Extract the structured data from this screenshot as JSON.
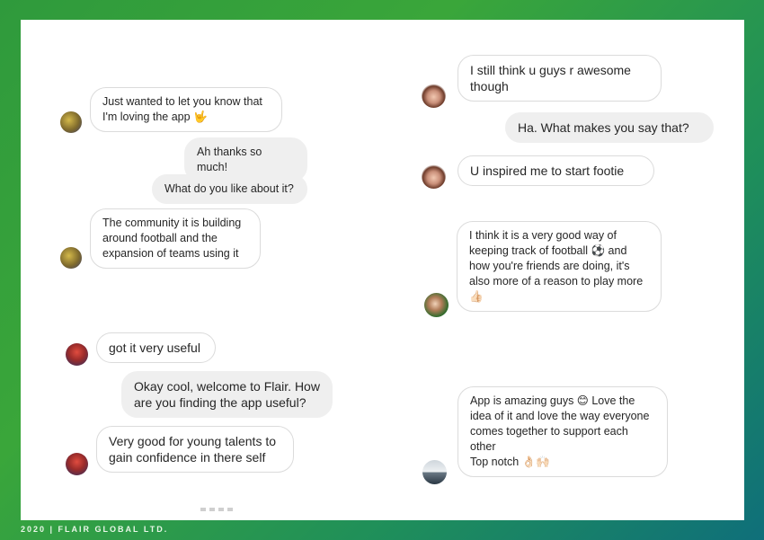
{
  "footer": {
    "text": "2020 | FLAIR GLOBAL LTD."
  },
  "left_chat": [
    {
      "side": "in",
      "text": "Just wanted to let you know that I'm loving the app",
      "emoji": "🤟"
    },
    {
      "side": "out",
      "text": "Ah thanks so much!"
    },
    {
      "side": "out",
      "text": "What do you like about it?"
    },
    {
      "side": "in",
      "text": "The community it is building around football and the expansion of teams using it"
    },
    {
      "side": "in",
      "text": "got it very useful"
    },
    {
      "side": "out",
      "text": "Okay cool, welcome to Flair. How are you finding the app useful?"
    },
    {
      "side": "in",
      "text": "Very good for young talents to gain confidence in there self"
    }
  ],
  "right_chat": [
    {
      "side": "in",
      "text": "I still think u guys r awesome though"
    },
    {
      "side": "out",
      "text": "Ha. What makes you say that?"
    },
    {
      "side": "in",
      "text": "U inspired me to start footie"
    },
    {
      "side": "in",
      "text": "I think it is a very good way of keeping track of football ⚽ and how you're friends are doing, it's also more of a reason to play more",
      "emoji": "👍🏻"
    },
    {
      "side": "in",
      "text": "App is amazing guys 😊 Love the idea of it and love the way everyone comes together to support each other",
      "line2": "Top notch",
      "emoji": "👌🏻🙌🏻"
    }
  ],
  "icons": {
    "avatar_gold": "avatar-icon",
    "avatar_girl": "avatar-icon",
    "avatar_team": "avatar-icon",
    "avatar_player": "avatar-icon"
  }
}
